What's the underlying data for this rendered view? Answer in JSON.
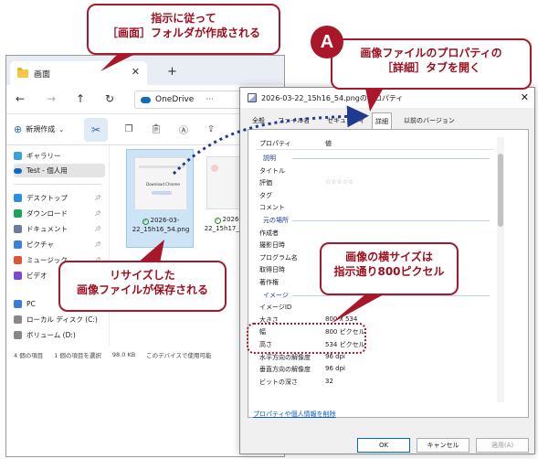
{
  "explorer": {
    "tab_title": "画面",
    "address": "OneDrive",
    "address_more": "···",
    "new_label": "新規作成",
    "sidebar": [
      {
        "label": "ギャラリー",
        "pinned": false
      },
      {
        "label": "Test - 個人用",
        "pinned": false
      },
      {
        "label": "デスクトップ",
        "pinned": true
      },
      {
        "label": "ダウンロード",
        "pinned": true
      },
      {
        "label": "ドキュメント",
        "pinned": true
      },
      {
        "label": "ピクチャ",
        "pinned": true
      },
      {
        "label": "ミュージック",
        "pinned": true
      },
      {
        "label": "ビデオ",
        "pinned": true
      },
      {
        "label": "PC",
        "pinned": false
      },
      {
        "label": "ローカル ディスク (C:)",
        "pinned": false
      },
      {
        "label": "ボリューム (D:)",
        "pinned": false
      }
    ],
    "files": [
      {
        "name": "2026-03-22_15h16_54.png",
        "selected": true,
        "thumb_text": "Download Chrome"
      },
      {
        "name": "2026-03-22_15h17_28.png",
        "selected": false,
        "thumb_text": ""
      }
    ],
    "status": {
      "count": "4 個の項目",
      "selected": "1 個の項目を選択",
      "size": "98.0 KB",
      "availability": "このデバイスで使用可能"
    }
  },
  "dialog": {
    "title": "2026-03-22_15h16_54.pngのプロパティ",
    "tabs": [
      "全般",
      "ファイル名",
      "セキュリティ",
      "詳細",
      "以前のバージョン"
    ],
    "active_tab": "詳細",
    "header_property": "プロパティ",
    "header_value": "値",
    "rows": [
      {
        "type": "section",
        "key": "説明",
        "value": ""
      },
      {
        "type": "row",
        "key": "タイトル",
        "value": ""
      },
      {
        "type": "row",
        "key": "評価",
        "value": "☆☆☆☆☆"
      },
      {
        "type": "row",
        "key": "タグ",
        "value": ""
      },
      {
        "type": "row",
        "key": "コメント",
        "value": ""
      },
      {
        "type": "section",
        "key": "元の場所",
        "value": ""
      },
      {
        "type": "row",
        "key": "作成者",
        "value": ""
      },
      {
        "type": "row",
        "key": "撮影日時",
        "value": ""
      },
      {
        "type": "row",
        "key": "プログラム名",
        "value": ""
      },
      {
        "type": "row",
        "key": "取得日時",
        "value": ""
      },
      {
        "type": "row",
        "key": "著作権",
        "value": ""
      },
      {
        "type": "section",
        "key": "イメージ",
        "value": ""
      },
      {
        "type": "row",
        "key": "イメージID",
        "value": ""
      },
      {
        "type": "row",
        "key": "大きさ",
        "value": "800 x 534"
      },
      {
        "type": "row",
        "key": "幅",
        "value": "800 ピクセル"
      },
      {
        "type": "row",
        "key": "高さ",
        "value": "534 ピクセル"
      },
      {
        "type": "row",
        "key": "水平方向の解像度",
        "value": "96 dpi"
      },
      {
        "type": "row",
        "key": "垂直方向の解像度",
        "value": "96 dpi"
      },
      {
        "type": "row",
        "key": "ビットの深さ",
        "value": "32"
      }
    ],
    "link": "プロパティや個人情報を削除",
    "ok": "OK",
    "cancel": "キャンセル",
    "apply": "適用(A)"
  },
  "annotations": {
    "folder_note": "指示に従って\n［画面］フォルダが作成される",
    "step_letter": "A",
    "tab_note": "画像ファイルのプロパティの\n［詳細］タブを開く",
    "file_note": "リサイズした\n画像ファイルが保存される",
    "size_note": "画像の横サイズは\n指示通り800ピクセル"
  },
  "colors": {
    "annotation": "#a8172a",
    "accent": "#0067c0",
    "teal": "#2e6f88"
  }
}
